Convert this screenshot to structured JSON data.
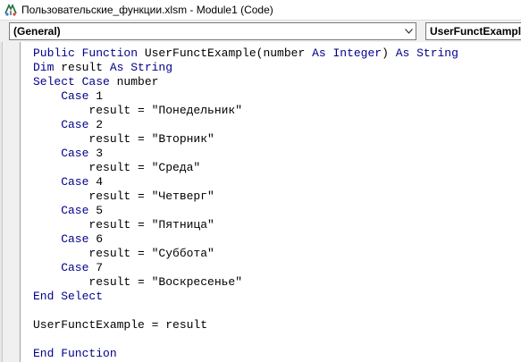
{
  "window": {
    "title": "Пользовательские_функции.xlsm - Module1 (Code)"
  },
  "toolbar": {
    "object_dropdown": "(General)",
    "procedure_dropdown": "UserFunctExample"
  },
  "code_lines": [
    [
      {
        "t": "Public Function ",
        "k": true
      },
      {
        "t": "UserFunctExample(number ",
        "k": false
      },
      {
        "t": "As Integer",
        "k": true
      },
      {
        "t": ") ",
        "k": false
      },
      {
        "t": "As String",
        "k": true
      }
    ],
    [
      {
        "t": "Dim ",
        "k": true
      },
      {
        "t": "result ",
        "k": false
      },
      {
        "t": "As String",
        "k": true
      }
    ],
    [
      {
        "t": "Select Case ",
        "k": true
      },
      {
        "t": "number",
        "k": false
      }
    ],
    [
      {
        "t": "    Case ",
        "k": true
      },
      {
        "t": "1",
        "k": false
      }
    ],
    [
      {
        "t": "        result = \"Понедельник\"",
        "k": false
      }
    ],
    [
      {
        "t": "    Case ",
        "k": true
      },
      {
        "t": "2",
        "k": false
      }
    ],
    [
      {
        "t": "        result = \"Вторник\"",
        "k": false
      }
    ],
    [
      {
        "t": "    Case ",
        "k": true
      },
      {
        "t": "3",
        "k": false
      }
    ],
    [
      {
        "t": "        result = \"Среда\"",
        "k": false
      }
    ],
    [
      {
        "t": "    Case ",
        "k": true
      },
      {
        "t": "4",
        "k": false
      }
    ],
    [
      {
        "t": "        result = \"Четверг\"",
        "k": false
      }
    ],
    [
      {
        "t": "    Case ",
        "k": true
      },
      {
        "t": "5",
        "k": false
      }
    ],
    [
      {
        "t": "        result = \"Пятница\"",
        "k": false
      }
    ],
    [
      {
        "t": "    Case ",
        "k": true
      },
      {
        "t": "6",
        "k": false
      }
    ],
    [
      {
        "t": "        result = \"Суббота\"",
        "k": false
      }
    ],
    [
      {
        "t": "    Case ",
        "k": true
      },
      {
        "t": "7",
        "k": false
      }
    ],
    [
      {
        "t": "        result = \"Воскресенье\"",
        "k": false
      }
    ],
    [
      {
        "t": "End Select",
        "k": true
      }
    ],
    [
      {
        "t": "",
        "k": false
      }
    ],
    [
      {
        "t": "UserFunctExample = result",
        "k": false
      }
    ],
    [
      {
        "t": "",
        "k": false
      }
    ],
    [
      {
        "t": "End Function",
        "k": true
      }
    ]
  ],
  "colors": {
    "keyword": "#00008b",
    "text": "#000000"
  }
}
